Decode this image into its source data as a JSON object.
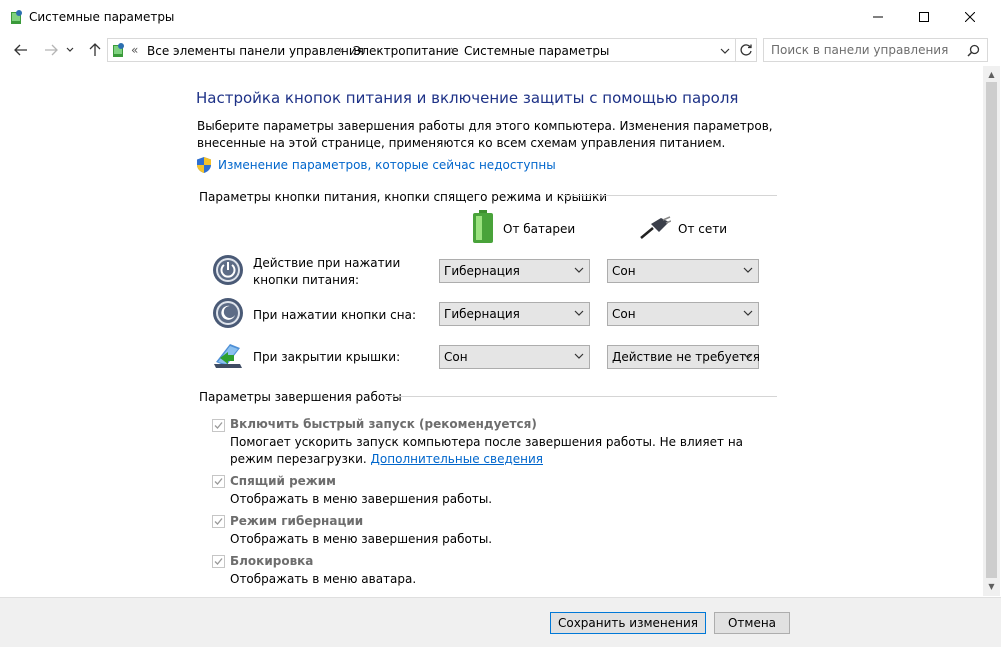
{
  "window": {
    "title": "Системные параметры"
  },
  "address": {
    "overflow": "«",
    "crumbs": [
      "Все элементы панели управления",
      "Электропитание",
      "Системные параметры"
    ]
  },
  "search": {
    "placeholder": "Поиск в панели управления"
  },
  "main": {
    "heading": "Настройка кнопок питания и включение защиты с помощью пароля",
    "description": "Выберите параметры завершения работы для этого компьютера. Изменения параметров, внесенные на этой странице, применяются ко всем схемам управления питанием.",
    "change_link": "Изменение параметров, которые сейчас недоступны"
  },
  "power_buttons": {
    "group_title": "Параметры кнопки питания, кнопки спящего режима и крышки",
    "col_battery": "От батареи",
    "col_ac": "От сети",
    "rows": [
      {
        "label": "Действие при нажатии кнопки питания:",
        "battery": "Гибернация",
        "ac": "Сон"
      },
      {
        "label": "При нажатии кнопки сна:",
        "battery": "Гибернация",
        "ac": "Сон"
      },
      {
        "label": "При закрытии крышки:",
        "battery": "Сон",
        "ac": "Действие не требуется"
      }
    ]
  },
  "shutdown": {
    "group_title": "Параметры завершения работы",
    "items": [
      {
        "title": "Включить быстрый запуск (рекомендуется)",
        "desc": "Помогает ускорить запуск компьютера после завершения работы. Не влияет на режим перезагрузки.",
        "link": "Дополнительные сведения",
        "checked": true
      },
      {
        "title": "Спящий режим",
        "desc": "Отображать в меню завершения работы.",
        "checked": true
      },
      {
        "title": "Режим гибернации",
        "desc": "Отображать в меню завершения работы.",
        "checked": true
      },
      {
        "title": "Блокировка",
        "desc": "Отображать в меню аватара.",
        "checked": true
      }
    ]
  },
  "footer": {
    "save": "Сохранить изменения",
    "cancel": "Отмена"
  },
  "colors": {
    "heading": "#1e3287",
    "link": "#0066cc",
    "accent": "#0078d7"
  }
}
